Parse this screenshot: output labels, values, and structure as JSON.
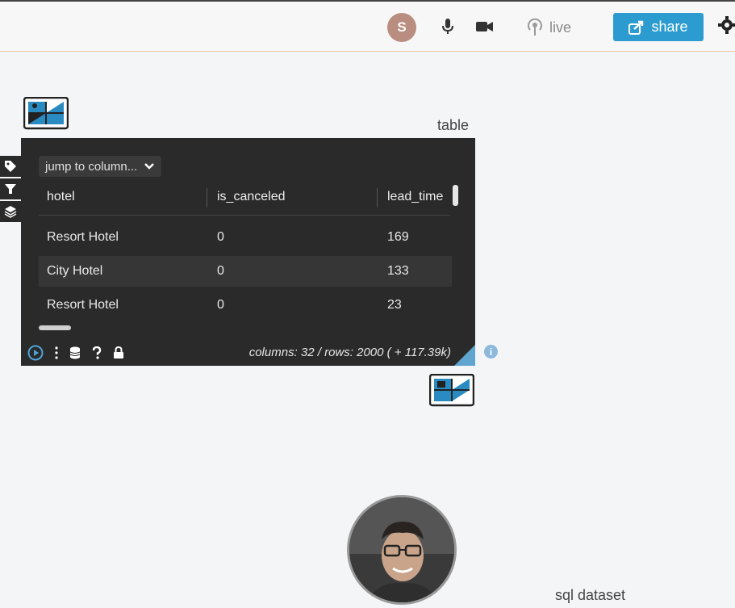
{
  "topbar": {
    "avatar_letter": "S",
    "live_label": "live",
    "share_label": "share"
  },
  "node": {
    "label": "table"
  },
  "table_panel": {
    "jump_label": "jump to column...",
    "columns": [
      "hotel",
      "is_canceled",
      "lead_time"
    ],
    "rows": [
      [
        "Resort Hotel",
        "0",
        "169"
      ],
      [
        "City Hotel",
        "0",
        "133"
      ],
      [
        "Resort Hotel",
        "0",
        "23"
      ]
    ],
    "footer_text": "columns: 32 / rows: 2000 ( + 117.39k)"
  },
  "bottom": {
    "label": "sql dataset"
  },
  "colors": {
    "accent": "#2c9cd0",
    "panel_bg": "#2a2a2a",
    "avatar": "#b98d7f"
  }
}
